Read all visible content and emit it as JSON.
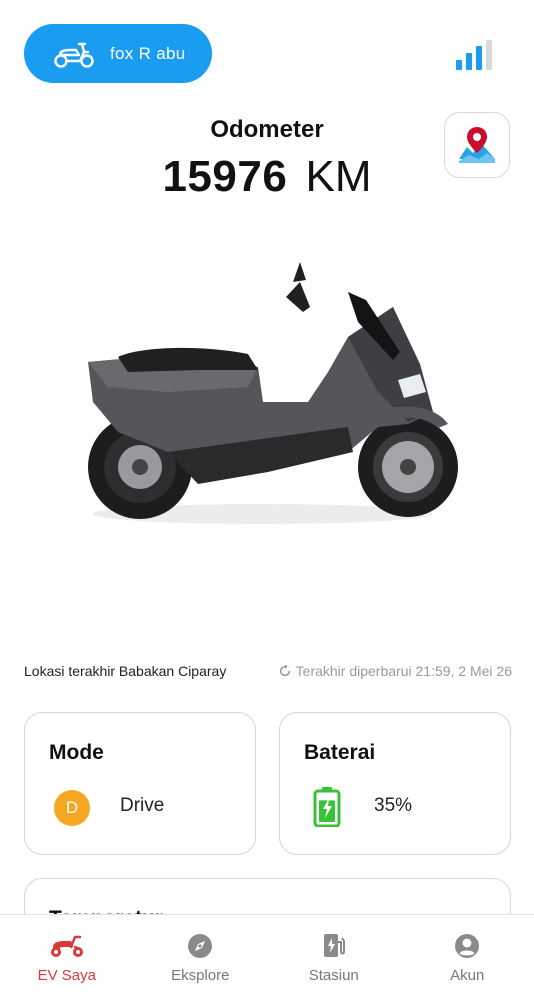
{
  "header": {
    "vehicle_name": "fox R abu"
  },
  "odometer": {
    "title": "Odometer",
    "value": "15976",
    "unit": "KM"
  },
  "status": {
    "last_location": "Lokasi terakhir Babakan Ciparay",
    "last_updated": "Terakhir diperbarui 21:59, 2 Mei 26"
  },
  "cards": {
    "mode": {
      "title": "Mode",
      "badge": "D",
      "value": "Drive"
    },
    "battery": {
      "title": "Baterai",
      "value": "35%",
      "level": 0.35
    },
    "third": {
      "title": "Temperatur"
    }
  },
  "bottom_nav": {
    "items": [
      {
        "label": "EV Saya",
        "icon": "scooter-icon",
        "active": true
      },
      {
        "label": "Eksplore",
        "icon": "compass-icon",
        "active": false
      },
      {
        "label": "Stasiun",
        "icon": "charging-station-icon",
        "active": false
      },
      {
        "label": "Akun",
        "icon": "account-icon",
        "active": false
      }
    ]
  },
  "colors": {
    "primary": "#1a9df0",
    "active_nav": "#d63a3a",
    "mode_badge": "#f5a623",
    "battery": "#3ac13a"
  }
}
